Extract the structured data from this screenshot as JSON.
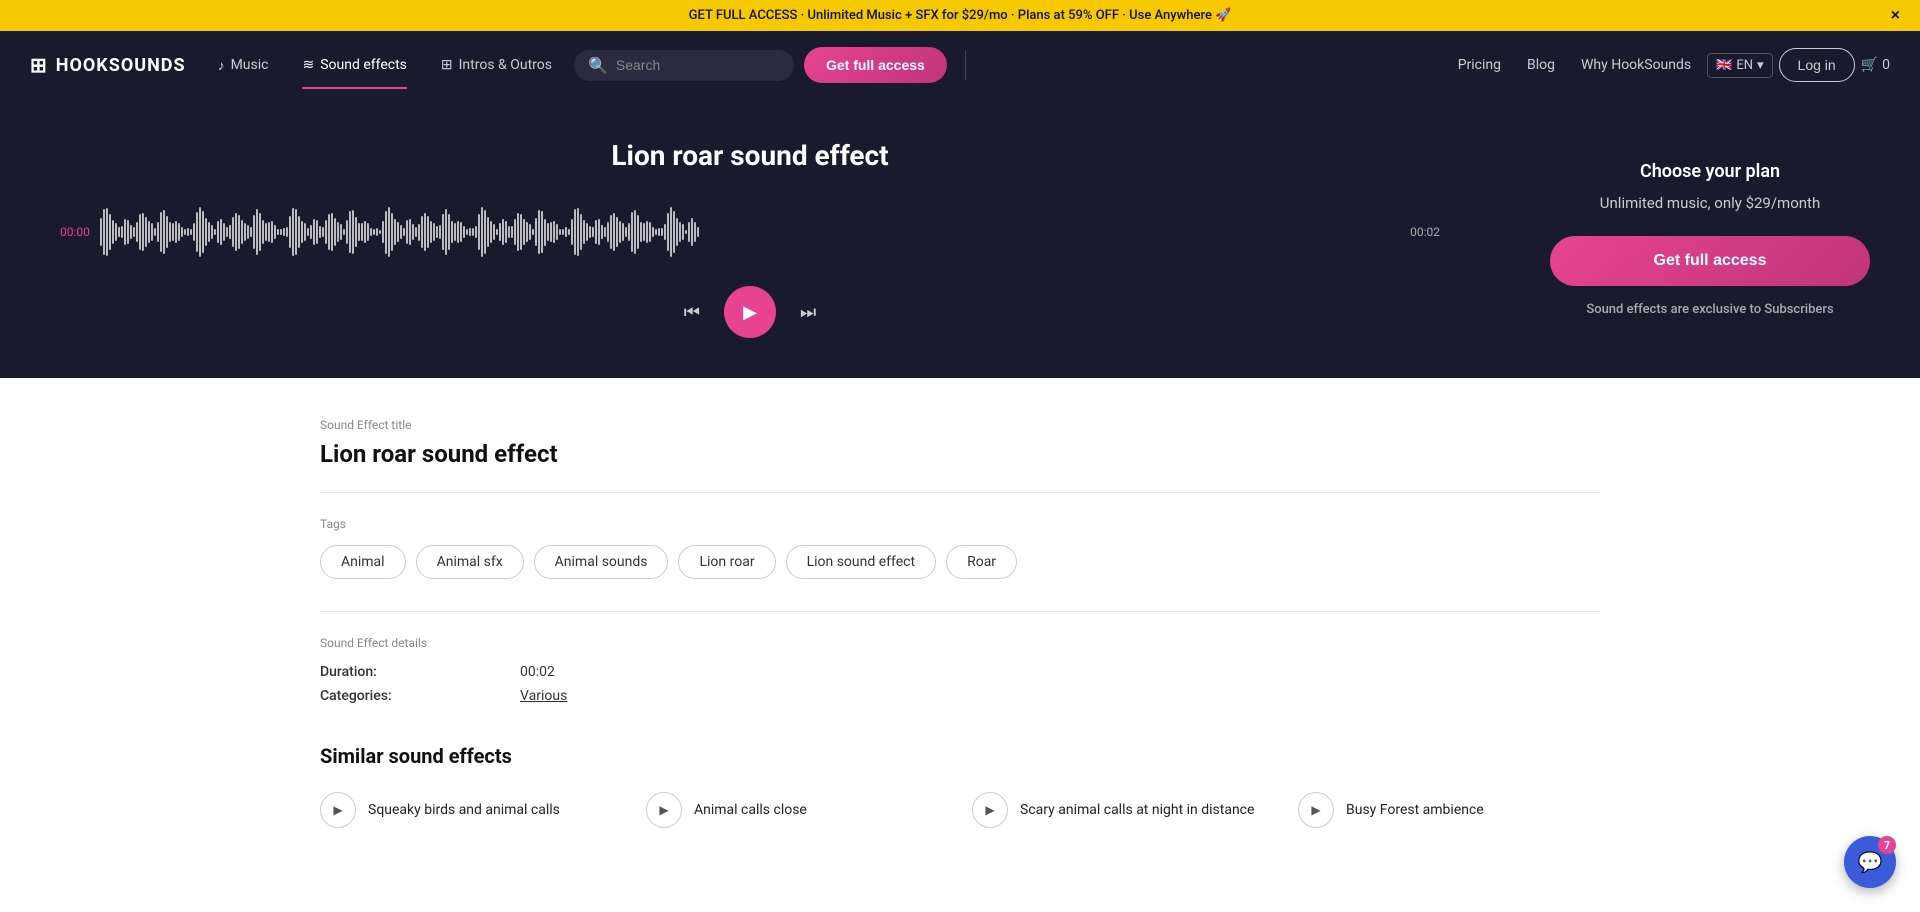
{
  "banner": {
    "text": "GET FULL ACCESS · Unlimited Music + SFX for $29/mo · Plans at 59% OFF · Use Anywhere 🚀",
    "close": "×"
  },
  "navbar": {
    "logo_text": "HOOKSOUNDS",
    "nav_items": [
      {
        "label": "Music",
        "icon": "♪",
        "active": false
      },
      {
        "label": "Sound effects",
        "icon": "≋",
        "active": true
      },
      {
        "label": "Intros & Outros",
        "icon": "⊞",
        "active": false
      }
    ],
    "search_placeholder": "Search",
    "get_full_access": "Get full access",
    "pricing": "Pricing",
    "blog": "Blog",
    "why": "Why HookSounds",
    "login": "Log in",
    "cart": "0",
    "lang": "EN"
  },
  "hero": {
    "title": "Lion roar sound effect",
    "time_start": "00:00",
    "time_end": "00:02",
    "choose_plan": "Choose your plan",
    "pricing_desc": "Unlimited music, only $29/month",
    "get_full_access_btn": "Get full access",
    "exclusive_note": "Sound effects are exclusive to Subscribers"
  },
  "content": {
    "section_label": "Sound Effect title",
    "title": "Lion roar sound effect",
    "tags_label": "Tags",
    "tags": [
      "Animal",
      "Animal sfx",
      "Animal sounds",
      "Lion roar",
      "Lion sound effect",
      "Roar"
    ],
    "details_label": "Sound Effect details",
    "duration_key": "Duration:",
    "duration_val": "00:02",
    "categories_key": "Categories:",
    "categories_val": "Various"
  },
  "similar": {
    "title": "Similar sound effects",
    "items": [
      {
        "label": "Squeaky birds and animal calls"
      },
      {
        "label": "Animal calls close"
      },
      {
        "label": "Scary animal calls at night in distance"
      },
      {
        "label": "Busy Forest ambience"
      }
    ]
  },
  "chat": {
    "badge": "7"
  }
}
